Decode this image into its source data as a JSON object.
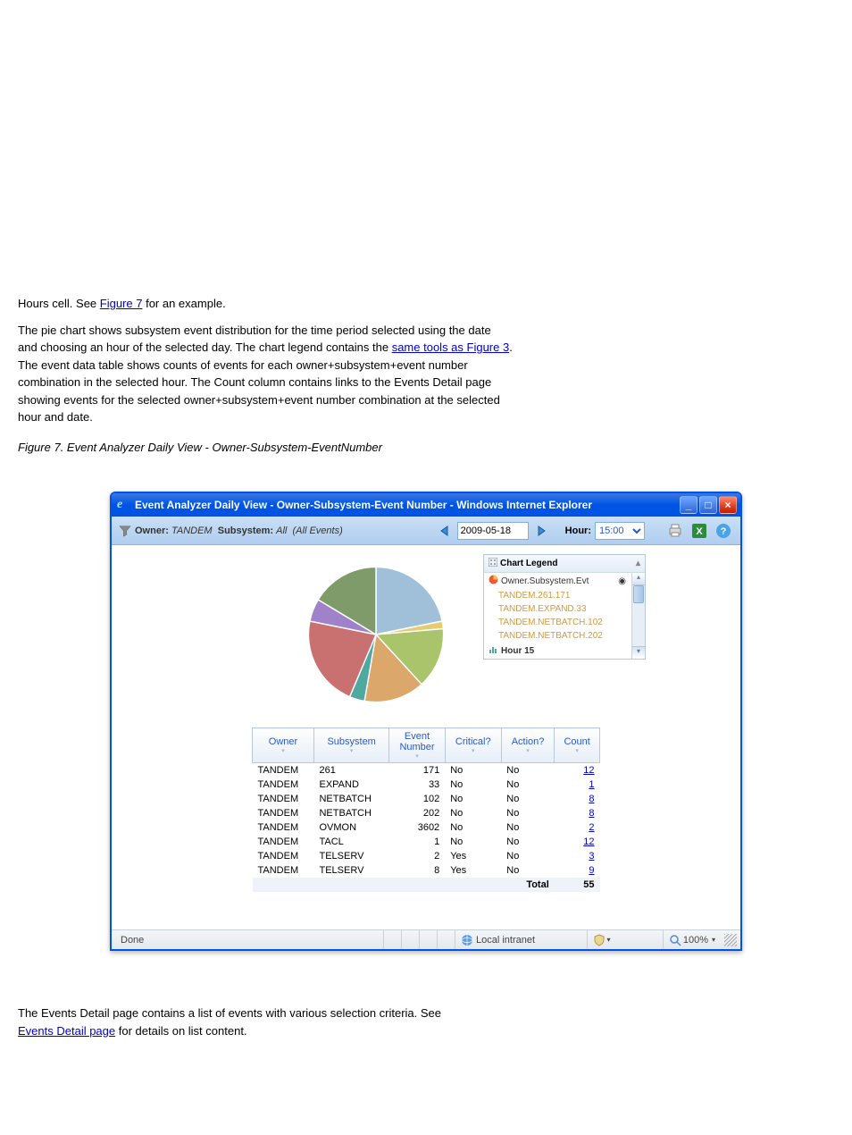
{
  "doc": {
    "line1_pre": "Hours cell. See ",
    "line1_link": "Figure 7",
    "line1_post": " for an example.",
    "subtext1": "The pie chart shows subsystem event distribution for the time period selected using the date ",
    "subtext2": "and choosing an hour of the selected day. The chart legend contains the ",
    "subtext2_link": "same tools as Figure 3",
    "subtext2_post": ". ",
    "subtext3": "The event data table shows counts of events for each owner+subsystem+event number ",
    "subtext4": "combination in the selected hour. The Count column contains links to the Events Detail page ",
    "subtext5": "showing events for the selected owner+subsystem+event number combination at the selected ",
    "subtext6": "hour and date.",
    "below1": "The Events Detail page contains a list of events with various selection criteria. See ",
    "below_link": "Events Detail page",
    "below1_post": " for details on list content. ",
    "fig_caption": "Figure 7. Event Analyzer Daily View - Owner-Subsystem-EventNumber "
  },
  "window": {
    "title": "Event Analyzer Daily View - Owner-Subsystem-Event Number - Windows Internet Explorer"
  },
  "toolbar": {
    "owner_label": "Owner:",
    "owner_value": "TANDEM",
    "subsys_label": "Subsystem:",
    "subsys_value": "All",
    "events_note": "(All Events)",
    "date": "2009-05-18",
    "hour_label": "Hour:",
    "hour_value": "15:00"
  },
  "legend": {
    "title": "Chart Legend",
    "series_label": "Owner.Subsystem.Evt",
    "items": [
      "TANDEM.261.171",
      "TANDEM.EXPAND.33",
      "TANDEM.NETBATCH.102",
      "TANDEM.NETBATCH.202"
    ],
    "hour_line": "Hour 15"
  },
  "table": {
    "headers": [
      "Owner",
      "Subsystem",
      "Event Number",
      "Critical?",
      "Action?",
      "Count"
    ],
    "rows": [
      {
        "owner": "TANDEM",
        "subsystem": "261",
        "evt": "171",
        "critical": "No",
        "action": "No",
        "count": "12"
      },
      {
        "owner": "TANDEM",
        "subsystem": "EXPAND",
        "evt": "33",
        "critical": "No",
        "action": "No",
        "count": "1"
      },
      {
        "owner": "TANDEM",
        "subsystem": "NETBATCH",
        "evt": "102",
        "critical": "No",
        "action": "No",
        "count": "8"
      },
      {
        "owner": "TANDEM",
        "subsystem": "NETBATCH",
        "evt": "202",
        "critical": "No",
        "action": "No",
        "count": "8"
      },
      {
        "owner": "TANDEM",
        "subsystem": "OVMON",
        "evt": "3602",
        "critical": "No",
        "action": "No",
        "count": "2"
      },
      {
        "owner": "TANDEM",
        "subsystem": "TACL",
        "evt": "1",
        "critical": "No",
        "action": "No",
        "count": "12"
      },
      {
        "owner": "TANDEM",
        "subsystem": "TELSERV",
        "evt": "2",
        "critical": "Yes",
        "action": "No",
        "count": "3"
      },
      {
        "owner": "TANDEM",
        "subsystem": "TELSERV",
        "evt": "8",
        "critical": "Yes",
        "action": "No",
        "count": "9"
      }
    ],
    "total_label": "Total",
    "total_value": "55"
  },
  "status": {
    "done": "Done",
    "zone": "Local intranet",
    "zoom": "100%"
  },
  "chart_data": {
    "type": "pie",
    "title": "",
    "series": [
      {
        "name": "TANDEM.261.171",
        "value": 12,
        "color": "#a0bfd9"
      },
      {
        "name": "TANDEM.EXPAND.33",
        "value": 1,
        "color": "#e5cc6f"
      },
      {
        "name": "TANDEM.NETBATCH.102",
        "value": 8,
        "color": "#a9c46a"
      },
      {
        "name": "TANDEM.NETBATCH.202",
        "value": 8,
        "color": "#dba76a"
      },
      {
        "name": "TANDEM.OVMON.3602",
        "value": 2,
        "color": "#4fa9a0"
      },
      {
        "name": "TANDEM.TACL.1",
        "value": 12,
        "color": "#c97070"
      },
      {
        "name": "TANDEM.TELSERV.2",
        "value": 3,
        "color": "#9f82c9"
      },
      {
        "name": "TANDEM.TELSERV.8",
        "value": 9,
        "color": "#7f9b6a"
      }
    ]
  }
}
